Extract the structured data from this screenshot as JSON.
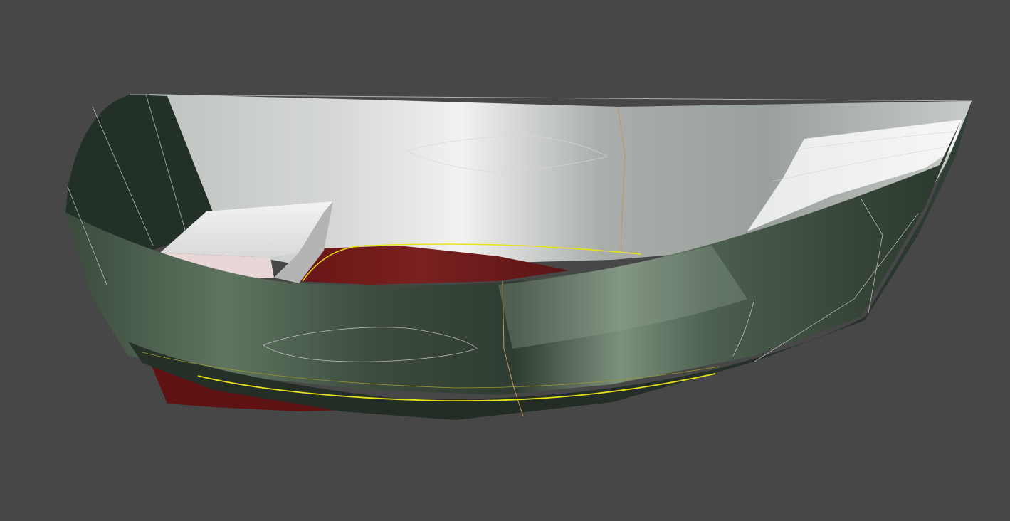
{
  "viewport": {
    "background_color": "#474747"
  },
  "model": {
    "description_shown": false,
    "hull_color": "#2c3a2e",
    "hull_highlight_color": "#7b8e7b",
    "interior_color": "#c8cbc8",
    "bottom_color": "#6e1414",
    "waterline_color": "#e8e21a",
    "edge_line_color": "#d7d7d7",
    "centerline_color": "#c7935a"
  }
}
